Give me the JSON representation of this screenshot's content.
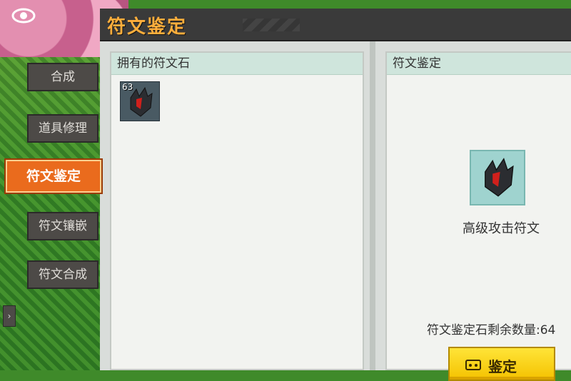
{
  "window": {
    "title": "符文鉴定"
  },
  "sidebar": {
    "tabs": [
      {
        "label": "合成",
        "active": false
      },
      {
        "label": "道具修理",
        "active": false
      },
      {
        "label": "符文鉴定",
        "active": true
      },
      {
        "label": "符文镶嵌",
        "active": false
      },
      {
        "label": "符文合成",
        "active": false
      }
    ],
    "collapse_icon": "chevron-right-icon"
  },
  "left_panel": {
    "header": "拥有的符文石",
    "items": [
      {
        "icon": "rune-stone-icon",
        "count": "63"
      }
    ]
  },
  "right_panel": {
    "header": "符文鉴定",
    "selected_item_name": "高级攻击符文",
    "remaining_label": "符文鉴定石剩余数量:64",
    "identify_button": "鉴定"
  },
  "icons": {
    "visibility": "eye-icon",
    "identify_button_icon": "gamepad-icon"
  },
  "colors": {
    "title": "#ffae3c",
    "active_tab": "#ea6b1d",
    "button": "#f4c200",
    "header_bg": "#cfe5dc"
  }
}
